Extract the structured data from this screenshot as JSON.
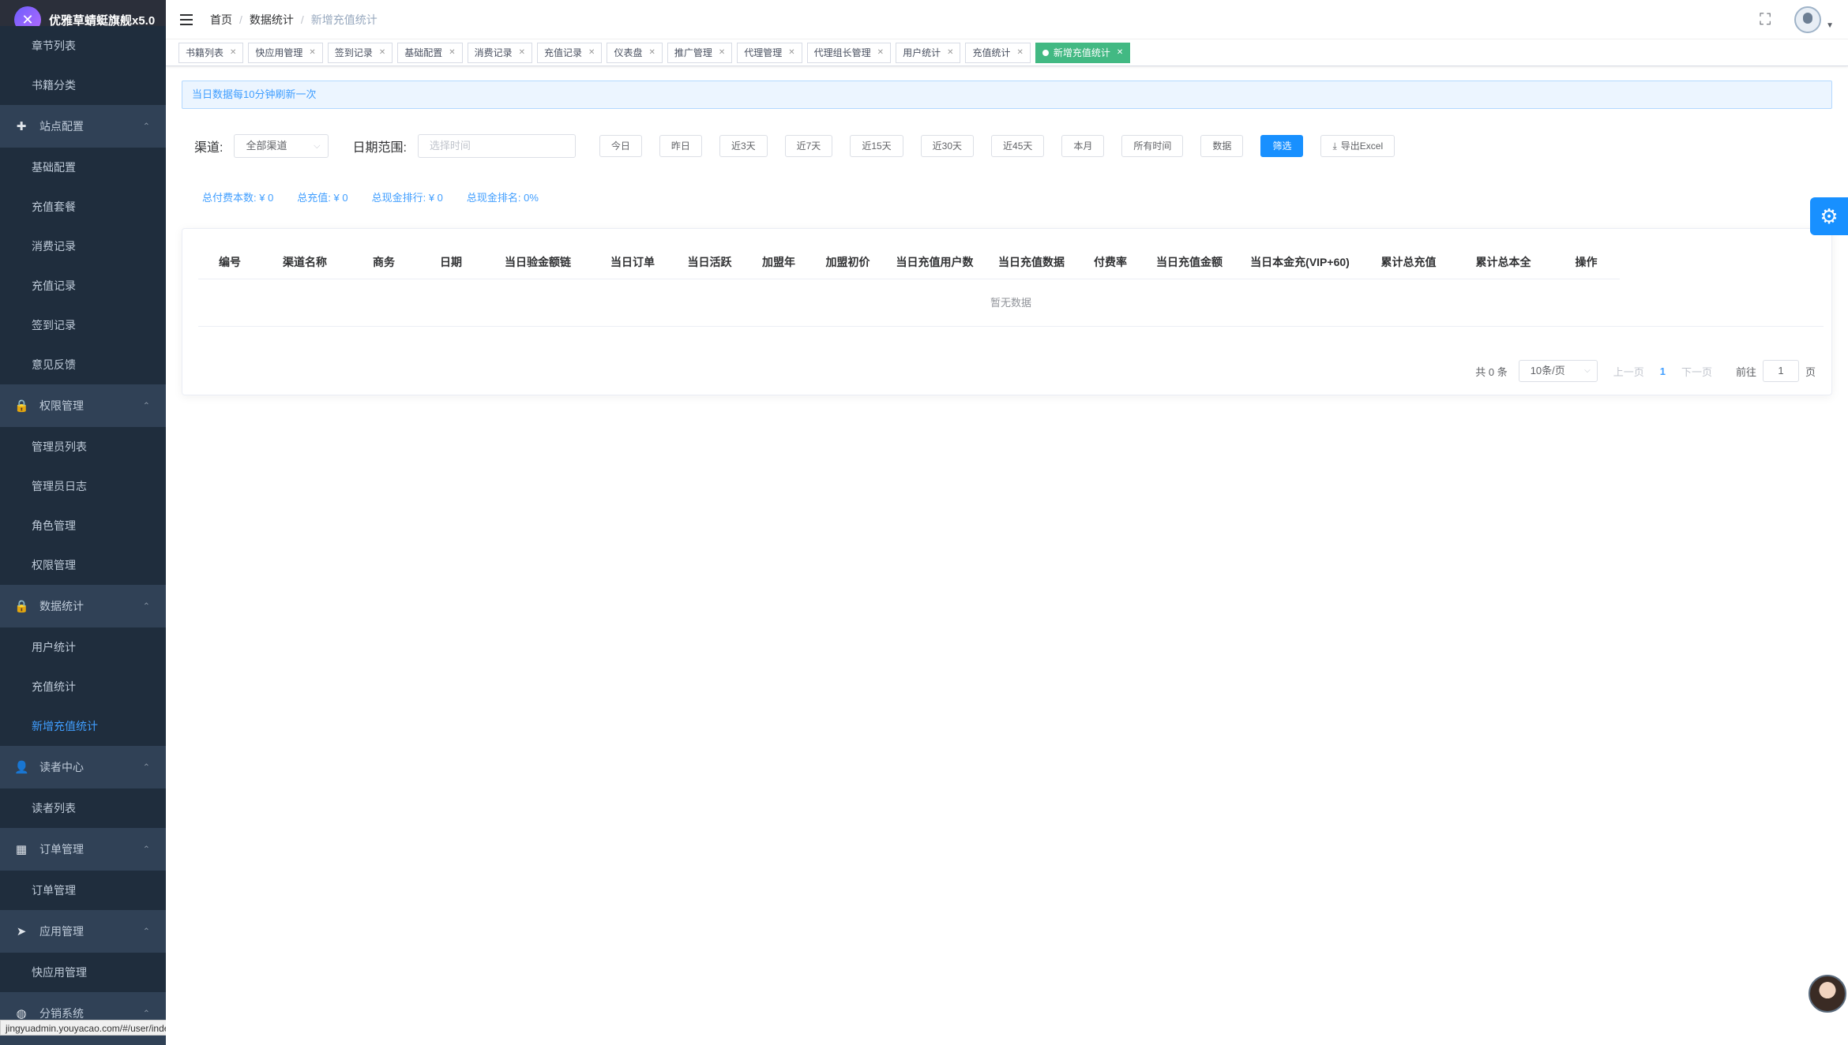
{
  "app": {
    "title": "优雅草蜻蜓旗舰x5.0"
  },
  "sidebar": {
    "items": [
      {
        "type": "sub",
        "label": "章节列表"
      },
      {
        "type": "sub",
        "label": "书籍分类"
      },
      {
        "type": "group",
        "label": "站点配置",
        "icon": "gear-plus-icon"
      },
      {
        "type": "sub",
        "label": "基础配置"
      },
      {
        "type": "sub",
        "label": "充值套餐"
      },
      {
        "type": "sub",
        "label": "消费记录"
      },
      {
        "type": "sub",
        "label": "充值记录"
      },
      {
        "type": "sub",
        "label": "签到记录"
      },
      {
        "type": "sub",
        "label": "意见反馈"
      },
      {
        "type": "group",
        "label": "权限管理",
        "icon": "lock-icon"
      },
      {
        "type": "sub",
        "label": "管理员列表"
      },
      {
        "type": "sub",
        "label": "管理员日志"
      },
      {
        "type": "sub",
        "label": "角色管理"
      },
      {
        "type": "sub",
        "label": "权限管理"
      },
      {
        "type": "group",
        "label": "数据统计",
        "icon": "lock-icon"
      },
      {
        "type": "sub",
        "label": "用户统计"
      },
      {
        "type": "sub",
        "label": "充值统计"
      },
      {
        "type": "sub",
        "label": "新增充值统计",
        "active": true
      },
      {
        "type": "group",
        "label": "读者中心",
        "icon": "user-icon"
      },
      {
        "type": "sub",
        "label": "读者列表"
      },
      {
        "type": "group",
        "label": "订单管理",
        "icon": "grid-icon"
      },
      {
        "type": "sub",
        "label": "订单管理"
      },
      {
        "type": "group",
        "label": "应用管理",
        "icon": "send-icon"
      },
      {
        "type": "sub",
        "label": "快应用管理"
      },
      {
        "type": "group",
        "label": "分销系统",
        "icon": "globe-icon"
      }
    ]
  },
  "status_url": "jingyuadmin.youyacao.com/#/user/index",
  "breadcrumb": {
    "home": "首页",
    "section": "数据统计",
    "current": "新增充值统计"
  },
  "tags": [
    {
      "label": "书籍列表"
    },
    {
      "label": "快应用管理"
    },
    {
      "label": "签到记录"
    },
    {
      "label": "基础配置"
    },
    {
      "label": "消费记录"
    },
    {
      "label": "充值记录"
    },
    {
      "label": "仪表盘"
    },
    {
      "label": "推广管理"
    },
    {
      "label": "代理管理"
    },
    {
      "label": "代理组长管理"
    },
    {
      "label": "用户统计"
    },
    {
      "label": "充值统计"
    },
    {
      "label": "新增充值统计",
      "active": true
    }
  ],
  "alert": "当日数据每10分钟刷新一次",
  "filters": {
    "channel_label": "渠道:",
    "channel_value": "全部渠道",
    "date_label": "日期范围:",
    "date_placeholder": "选择时间",
    "quick": [
      "今日",
      "昨日",
      "近3天",
      "近7天",
      "近15天",
      "近30天",
      "近45天",
      "本月",
      "所有时间",
      "数据"
    ],
    "filter_btn": "筛选",
    "export_btn": "导出Excel"
  },
  "totals": [
    "总付费本数: ¥ 0",
    "总充值: ¥ 0",
    "总现金排行: ¥ 0",
    "总现金排名: 0%"
  ],
  "table": {
    "columns": [
      "编号",
      "渠道名称",
      "商务",
      "日期",
      "当日验金额链",
      "当日订单",
      "当日活跃",
      "加盟年",
      "加盟初价",
      "当日充值用户数",
      "当日充值数据",
      "付费率",
      "当日充值金额",
      "当日本金充(VIP+60)",
      "累计总充值",
      "累计总本全",
      "操作"
    ],
    "empty": "暂无数据"
  },
  "pager": {
    "total": "共 0 条",
    "size": "10条/页",
    "prev": "上一页",
    "current": "1",
    "next": "下一页",
    "goto": "前往",
    "page_value": "1",
    "page_unit": "页"
  }
}
